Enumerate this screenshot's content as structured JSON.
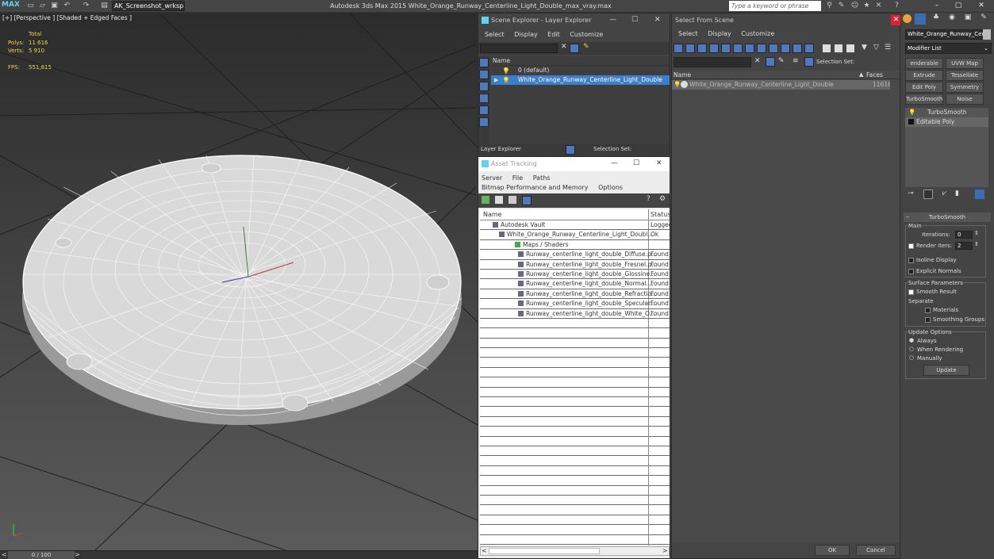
{
  "titlebar": {
    "workspace": "AK_Screenshot_wrksp",
    "app_title": "Autodesk 3ds Max  2015    White_Orange_Runway_Centerline_Light_Double_max_vray.max",
    "search_placeholder": "Type a keyword or phrase"
  },
  "viewport": {
    "label": "[+] [Perspective ] [Shaded + Edged Faces ]",
    "stats": {
      "total_label": "Total",
      "polys_label": "Polys:",
      "polys_value": "11 616",
      "verts_label": "Verts:",
      "verts_value": "5 910",
      "fps_label": "FPS:",
      "fps_value": "551,815"
    },
    "timeline": "0 / 100"
  },
  "scene_explorer": {
    "title": "Scene Explorer - Layer Explorer",
    "menu": [
      "Select",
      "Display",
      "Edit",
      "Customize"
    ],
    "col_name": "Name",
    "rows": [
      "0 (default)",
      "White_Orange_Runway_Centerline_Light_Double"
    ],
    "footer_label": "Layer Explorer",
    "selection_set": "Selection Set:"
  },
  "asset_tracking": {
    "title": "Asset Tracking",
    "menu": [
      "Server",
      "File",
      "Paths",
      "Bitmap Performance and Memory",
      "Options"
    ],
    "col_name": "Name",
    "col_status": "Status",
    "rows": [
      {
        "name": "Autodesk Vault",
        "status": "Logged"
      },
      {
        "name": "White_Orange_Runway_Centerline_Light_Doubl...",
        "status": "Ok"
      },
      {
        "name": "Maps / Shaders",
        "status": ""
      },
      {
        "name": "Runway_centerline_light_double_Diffuse.p...",
        "status": "Found"
      },
      {
        "name": "Runway_centerline_light_double_Fresnel.p...",
        "status": "Found"
      },
      {
        "name": "Runway_centerline_light_double_Glossine...",
        "status": "Found"
      },
      {
        "name": "Runway_centerline_light_double_Normal....",
        "status": "Found"
      },
      {
        "name": "Runway_centerline_light_double_Refractio...",
        "status": "Found"
      },
      {
        "name": "Runway_centerline_light_double_Specular...",
        "status": "Found"
      },
      {
        "name": "Runway_centerline_light_double_White_O...",
        "status": "Found"
      }
    ]
  },
  "select_from_scene": {
    "title": "Select From Scene",
    "menu": [
      "Select",
      "Display",
      "Customize"
    ],
    "selection_set": "Selection Set:",
    "col_name": "Name",
    "col_faces": "Faces",
    "rows": [
      {
        "name": "White_Orange_Runway_Centerline_Light_Double",
        "faces": "11616"
      }
    ],
    "ok": "OK",
    "cancel": "Cancel"
  },
  "command_panel": {
    "object_name": "White_Orange_Runway_Cen",
    "modifier_list": "Modifier List",
    "buttons": [
      "enderable Spli",
      "UVW Map",
      "Extrude",
      "Tessellate",
      "Edit Poly",
      "Symmetry",
      "TurboSmooth",
      "Noise"
    ],
    "stack": [
      "TurboSmooth",
      "Editable Poly"
    ],
    "rollout_title": "TurboSmooth",
    "main_label": "Main",
    "iterations_label": "Iterations:",
    "iterations_value": "0",
    "render_iters_label": "Render Iters:",
    "render_iters_value": "2",
    "isoline": "Isoline Display",
    "explicit_normals": "Explicit Normals",
    "surface_params": "Surface Parameters",
    "smooth_result": "Smooth Result",
    "separate": "Separate",
    "materials": "Materials",
    "smoothing_groups": "Smoothing Groups",
    "update_options": "Update Options",
    "always": "Always",
    "when_rendering": "When Rendering",
    "manually": "Manually",
    "update": "Update"
  }
}
